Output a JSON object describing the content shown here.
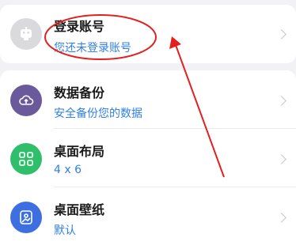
{
  "account": {
    "title": "登录账号",
    "subtitle": "您还未登录账号",
    "icon": "robot-avatar-icon"
  },
  "settings": [
    {
      "title": "数据备份",
      "subtitle": "安全备份您的数据",
      "icon": "cloud-backup-icon",
      "color": "#6a5a9c"
    },
    {
      "title": "桌面布局",
      "subtitle": "4 x 6",
      "icon": "grid-layout-icon",
      "color": "#2fbf6a"
    },
    {
      "title": "桌面壁纸",
      "subtitle": "默认",
      "icon": "wallpaper-icon",
      "color": "#3e6fe0"
    }
  ],
  "colors": {
    "accent": "#2f7fe6",
    "annotation": "#e32020"
  }
}
